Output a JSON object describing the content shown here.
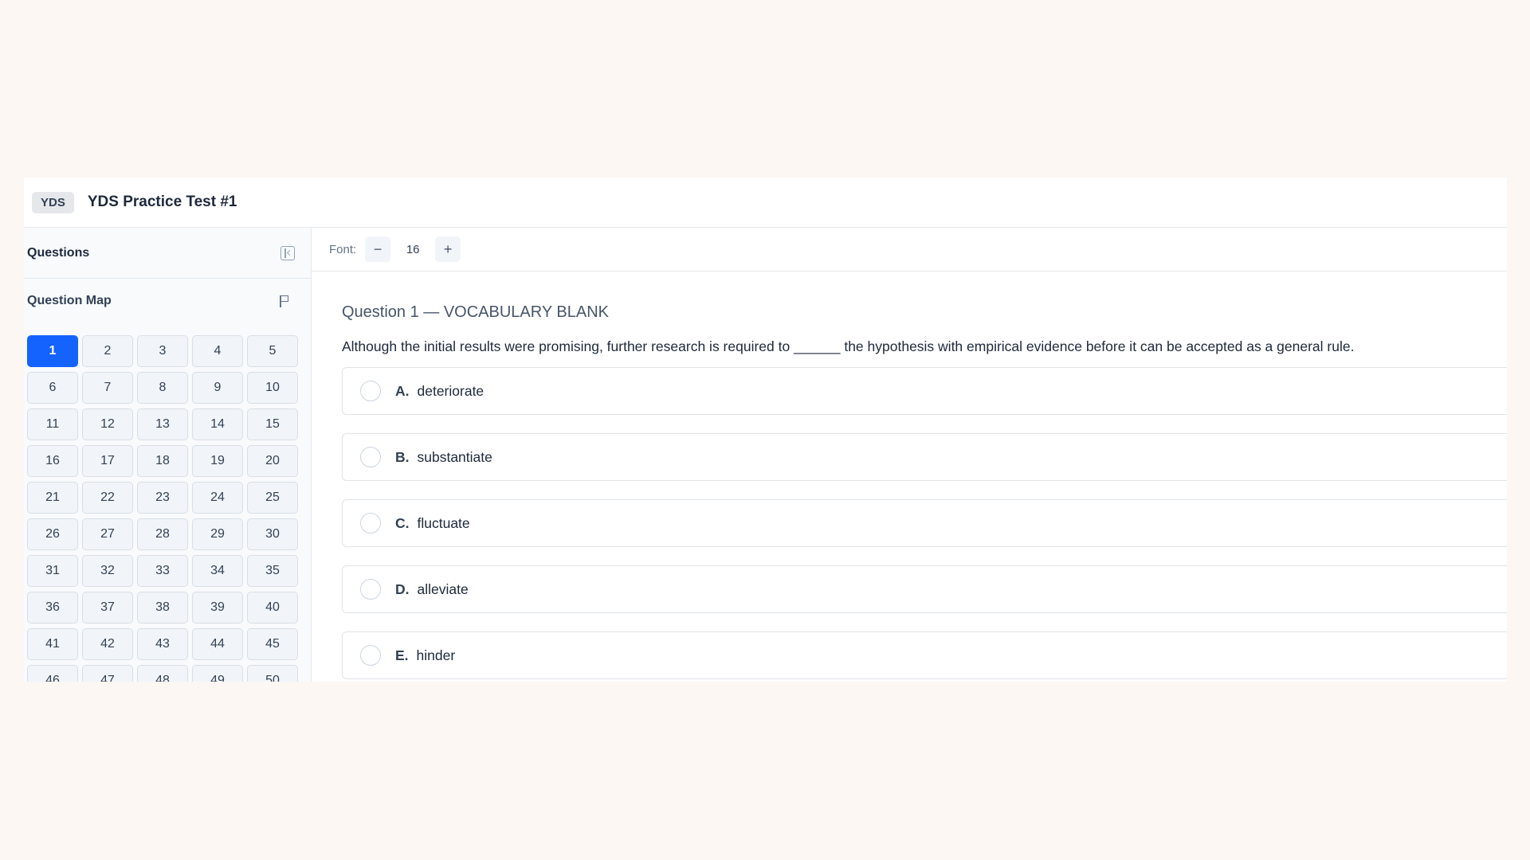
{
  "header": {
    "badge": "YDS",
    "title": "YDS Practice Test #1"
  },
  "sidebar": {
    "title": "Questions",
    "collapse_icon": "collapse-sidebar-icon",
    "map_title": "Question Map",
    "flag_icon": "flag-icon",
    "active_question": "1",
    "question_numbers": [
      "1",
      "2",
      "3",
      "4",
      "5",
      "6",
      "7",
      "8",
      "9",
      "10",
      "11",
      "12",
      "13",
      "14",
      "15",
      "16",
      "17",
      "18",
      "19",
      "20",
      "21",
      "22",
      "23",
      "24",
      "25",
      "26",
      "27",
      "28",
      "29",
      "30",
      "31",
      "32",
      "33",
      "34",
      "35",
      "36",
      "37",
      "38",
      "39",
      "40",
      "41",
      "42",
      "43",
      "44",
      "45",
      "46",
      "47",
      "48",
      "49",
      "50"
    ]
  },
  "toolbar": {
    "font_label": "Font:",
    "decrease_label": "−",
    "font_size": "16",
    "increase_label": "+"
  },
  "question": {
    "header": "Question 1 — VOCABULARY BLANK",
    "text": "Although the initial results were promising, further research is required to ______ the hypothesis with empirical evidence before it can be accepted as a general rule.",
    "options": [
      {
        "letter": "A.",
        "text": "deteriorate"
      },
      {
        "letter": "B.",
        "text": "substantiate"
      },
      {
        "letter": "C.",
        "text": "fluctuate"
      },
      {
        "letter": "D.",
        "text": "alleviate"
      },
      {
        "letter": "E.",
        "text": "hinder"
      }
    ]
  },
  "colors": {
    "accent": "#1463ff",
    "background": "#fcf7f3"
  }
}
